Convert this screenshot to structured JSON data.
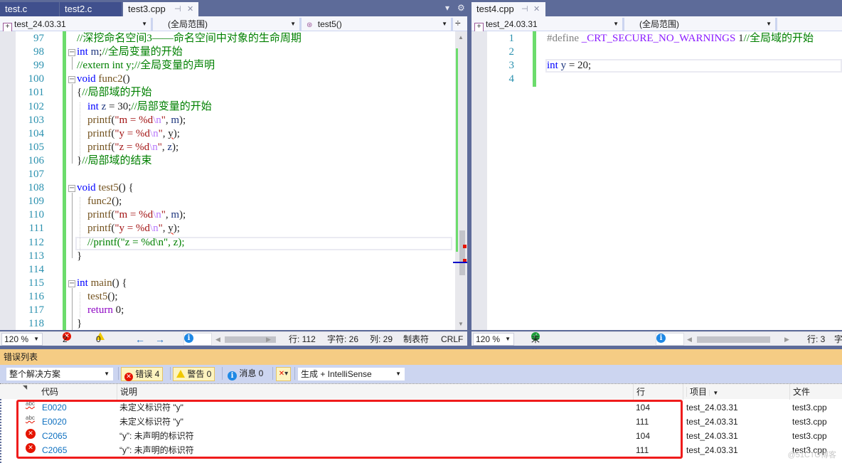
{
  "left_pane": {
    "tabs": [
      {
        "label": "test.c",
        "active": false
      },
      {
        "label": "test2.c",
        "active": false
      },
      {
        "label": "test3.cpp",
        "active": true,
        "pin": "⊣",
        "close": "✕"
      }
    ],
    "tab_overflow_icon": "▾",
    "settings_icon": "⚙",
    "nav": {
      "project": "test_24.03.31",
      "scope": "(全局范围)",
      "member": "test5()",
      "split_icon": "÷"
    },
    "code_lines": [
      {
        "n": "97",
        "html": "<span class='cm'>//深挖命名空间3——命名空间中对象的生命周期</span>"
      },
      {
        "n": "98",
        "html": "<span class='kw'>int</span> <span class='id'>m</span>;<span class='cm'>//全局变量的开始</span>"
      },
      {
        "n": "99",
        "html": "<span class='cm'>//extern int y;//全局变量的声明</span>"
      },
      {
        "n": "100",
        "html": "<span class='kw'>void</span> <span class='fn'>func2</span>()"
      },
      {
        "n": "101",
        "html": "{<span class='cm'>//局部域的开始</span>"
      },
      {
        "n": "102",
        "html": "    <span class='kw'>int</span> <span class='id'>z</span> = 30;<span class='cm'>//局部变量的开始</span>"
      },
      {
        "n": "103",
        "html": "    <span class='fn'>printf</span>(<span class='st'>\"m = %d<span class='esc'>\\n</span>\"</span>, <span class='id'>m</span>);"
      },
      {
        "n": "104",
        "html": "    <span class='fn'>printf</span>(<span class='st'>\"y = %d<span class='esc'>\\n</span>\"</span>, <span class='squig'>y</span>);"
      },
      {
        "n": "105",
        "html": "    <span class='fn'>printf</span>(<span class='st'>\"z = %d<span class='esc'>\\n</span>\"</span>, <span class='id'>z</span>);"
      },
      {
        "n": "106",
        "html": "}<span class='cm'>//局部域的结束</span>"
      },
      {
        "n": "107",
        "html": ""
      },
      {
        "n": "108",
        "html": "<span class='kw'>void</span> <span class='fn'>test5</span>() {"
      },
      {
        "n": "109",
        "html": "    <span class='fn'>func2</span>();"
      },
      {
        "n": "110",
        "html": "    <span class='fn'>printf</span>(<span class='st'>\"m = %d<span class='esc'>\\n</span>\"</span>, <span class='id'>m</span>);"
      },
      {
        "n": "111",
        "html": "    <span class='fn'>printf</span>(<span class='st'>\"y = %d<span class='esc'>\\n</span>\"</span>, <span class='squig'>y</span>);"
      },
      {
        "n": "112",
        "html": "    <span class='cm'>//printf(\"z = %d\\n\", z);</span>"
      },
      {
        "n": "113",
        "html": "}"
      },
      {
        "n": "114",
        "html": ""
      },
      {
        "n": "115",
        "html": "<span class='kw'>int</span> <span class='fn'>main</span>() {"
      },
      {
        "n": "116",
        "html": "    <span class='fn'>test5</span>();"
      },
      {
        "n": "117",
        "html": "    <span class='ctl'>return</span> 0;"
      },
      {
        "n": "118",
        "html": "}"
      }
    ],
    "status": {
      "zoom": "120 %",
      "errors": "2",
      "warnings": "0",
      "back_icon": "←",
      "forward_icon": "→",
      "line": "行: 112",
      "char": "字符: 26",
      "col": "列: 29",
      "indent": "制表符",
      "eol": "CRLF"
    }
  },
  "right_pane": {
    "tab": {
      "label": "test4.cpp",
      "pin": "⊣",
      "close": "✕"
    },
    "nav": {
      "project": "test_24.03.31",
      "scope": "(全局范围)"
    },
    "code_lines": [
      {
        "n": "1",
        "html": "<span class='pp'>#define</span> <span class='mac'>_CRT_SECURE_NO_WARNINGS</span> 1<span class='cm'>//全局域的开始</span>"
      },
      {
        "n": "2",
        "html": ""
      },
      {
        "n": "3",
        "html": "<span class='kw'>int</span> <span class='id'>y</span> = 20;"
      },
      {
        "n": "4",
        "html": ""
      }
    ],
    "status": {
      "zoom": "120 %",
      "no_issues": "未找到相关问题",
      "line": "行: 3",
      "char_partial": "字"
    }
  },
  "error_list": {
    "title": "错误列表",
    "scope_filter": "整个解决方案",
    "errors_toggle": "错误 4",
    "warnings_toggle": "警告 0",
    "messages_toggle": "消息 0",
    "build_filter": "生成 + IntelliSense",
    "columns": {
      "code": "代码",
      "description": "说明",
      "line": "行",
      "project": "项目",
      "file": "文件"
    },
    "rows": [
      {
        "icon": "intellisense",
        "code": "E0020",
        "description": "未定义标识符 \"y\"",
        "line": "104",
        "project": "test_24.03.31",
        "file": "test3.cpp"
      },
      {
        "icon": "intellisense",
        "code": "E0020",
        "description": "未定义标识符 \"y\"",
        "line": "111",
        "project": "test_24.03.31",
        "file": "test3.cpp"
      },
      {
        "icon": "error",
        "code": "C2065",
        "description": "“y”: 未声明的标识符",
        "line": "104",
        "project": "test_24.03.31",
        "file": "test3.cpp"
      },
      {
        "icon": "error",
        "code": "C2065",
        "description": "“y”: 未声明的标识符",
        "line": "111",
        "project": "test_24.03.31",
        "file": "test3.cpp"
      }
    ],
    "watermark": "@51CTO博客"
  }
}
